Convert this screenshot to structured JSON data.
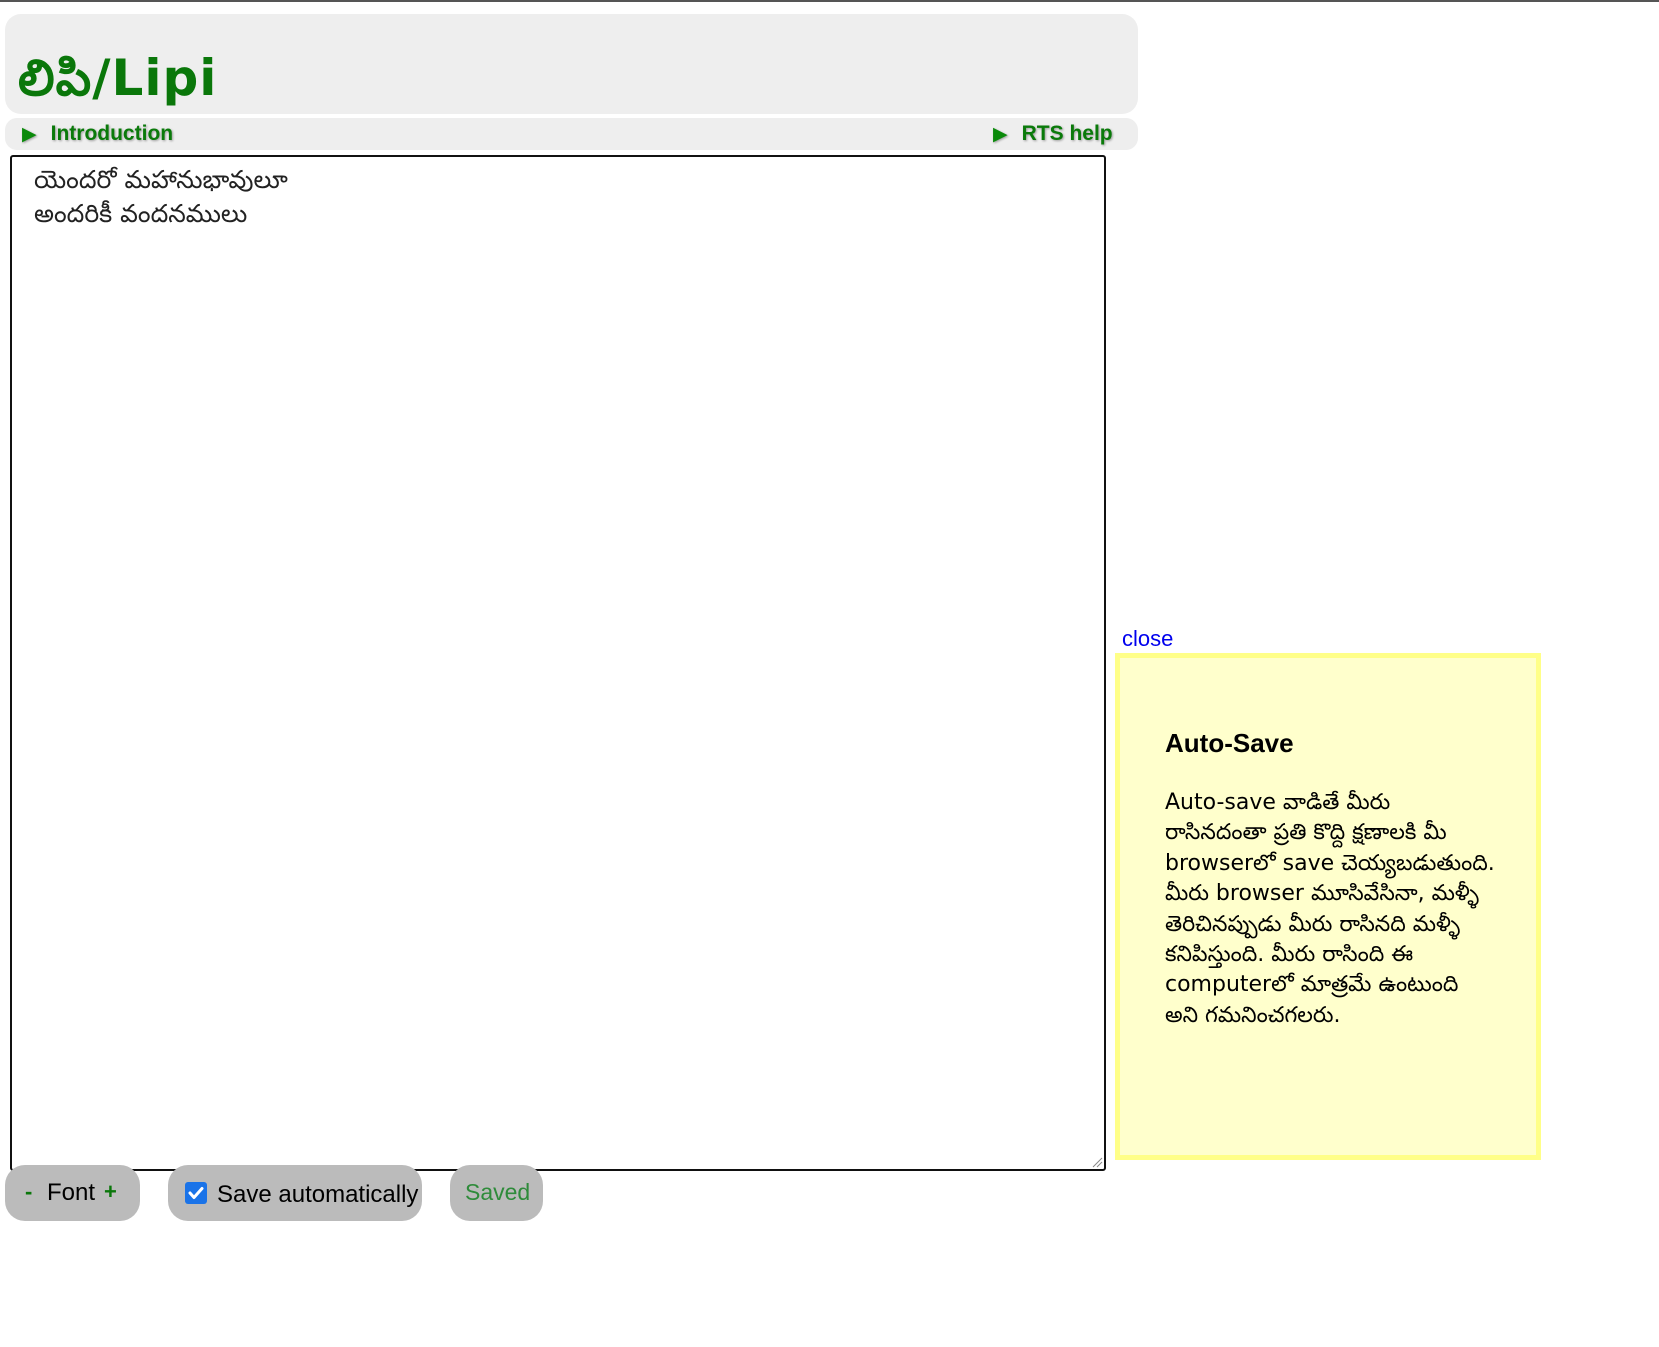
{
  "app": {
    "title": "లిపి/Lipi"
  },
  "nav": {
    "intro_label": "Introduction",
    "rts_help_label": "RTS help",
    "expand_glyph": "▶"
  },
  "editor": {
    "text": "యెందరో మహానుభావులూ\nఅందరికీ వందనములు"
  },
  "help_panel": {
    "close_label": "close",
    "title": "Auto-Save",
    "body": "Auto-save వాడితే మీరు రాసినదంతా ప్రతి కొద్ది క్షణాలకి మీ browserలో save చెయ్యబడుతుంది. మీరు browser మూసివేసినా, మళ్ళీ తెరిచినప్పుడు మీరు రాసినది మళ్ళీ కనిపిస్తుంది. మీరు రాసింది ఈ computerలో మాత్రమే ఉంటుంది అని గమనించగలరు."
  },
  "footer": {
    "font_decrease": "-",
    "font_label": "Font",
    "font_increase": "+",
    "autosave_label": "Save automatically",
    "autosave_checked": true,
    "status": "Saved"
  },
  "colors": {
    "brand_green": "#0a770a",
    "status_green": "#2e8b3a",
    "help_background": "#ffffcc",
    "help_border": "#ffff88",
    "link_blue": "#0000ee",
    "panel_gray": "#eeeeee",
    "pill_gray": "#bbbbbb"
  }
}
